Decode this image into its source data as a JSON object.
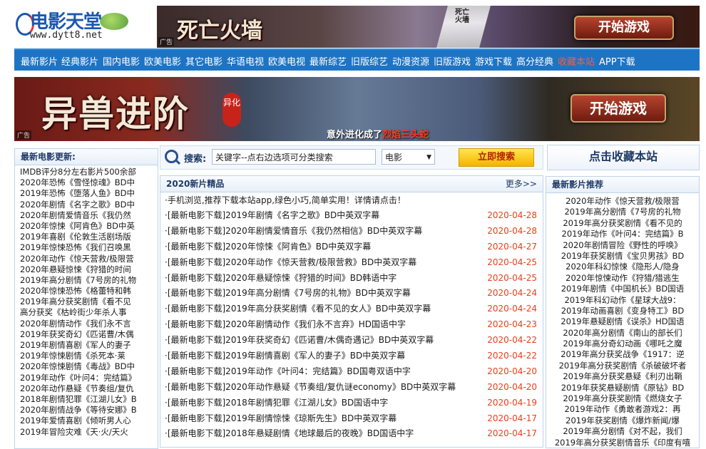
{
  "logo": {
    "title": "电影天堂",
    "url": "www.dytt8.net"
  },
  "top_banner": {
    "game_title": "死亡火墙",
    "sign_text": "死亡火墙",
    "button": "开始游戏",
    "ad_tag": "广告"
  },
  "nav": [
    "最新影片",
    "经典影片",
    "国内电影",
    "欧美电影",
    "其它电影",
    "华语电视",
    "欧美电视",
    "最新综艺",
    "旧版综艺",
    "动漫资源",
    "旧版游戏",
    "游戏下载",
    "高分经典",
    "收藏本站",
    "APP下载"
  ],
  "nav_highlight_color": "#ff5a3c",
  "mid_banner": {
    "title": "异兽进阶",
    "seal": "异化",
    "caption_prefix": "意外进化成了",
    "caption_highlight": "烈焰三头蛇",
    "button": "开始游戏",
    "ad_tag": "广告"
  },
  "left": {
    "title": "最新电影更新:",
    "items": [
      "IMDB评分8分左右影片500余部",
      "2020年恐怖《雪怪惊魂》BD中",
      "2019年恐怖《堕落人鱼》BD中",
      "2020年剧情《名字之歌》BD中",
      "2020年剧情爱情音乐《我仍然",
      "2020年惊悚《阿肯色》BD中英",
      "2019年喜剧《伦敦生活剧场版",
      "2019年惊悚恐怖《我们召唤黑",
      "2020年动作《惊天营救/极限营",
      "2020年悬疑惊悚《狩猎的时间",
      "2019年高分剧情《7号房的礼物",
      "2020年惊悚恐怖《格蕾特和韩",
      "2019年高分获奖剧情《看不见",
      "高分获奖《枯岭街少年杀人事",
      "2020年剧情动作《我们永不言",
      "2019年获奖奇幻《匹诺曹/木偶",
      "2019年剧情喜剧《军人的妻子",
      "2019年惊悚剧情《杀死本·莱",
      "2020年惊悚剧情《毒战》BD中",
      "2019年动作《叶问4：完结篇》",
      "2020年动作悬疑《节奏组/复仇",
      "2018年剧情犯罪《江湖儿女》B",
      "2020年剧情战争《等待安娜》B",
      "2019年爱情喜剧《倾听男人心",
      "2019年冒险灾难《天·火/天火"
    ]
  },
  "search": {
    "label": "搜索:",
    "input_value": "关键字--点右边选项可分类搜索",
    "category": "电影",
    "button": "立即搜索"
  },
  "favorite": "点击收藏本站",
  "center": {
    "title": "2020新片精品",
    "more": "更多>>",
    "notice": "·手机浏览,推荐下载本站app,绿色小巧,简单实用！详情请点击！",
    "date_color": "#e8401a",
    "rows": [
      {
        "text": "·[最新电影下载]2019年剧情《名字之歌》BD中英双字幕",
        "date": "2020-04-28"
      },
      {
        "text": "·[最新电影下载]2020年剧情爱情音乐《我仍然相信》BD中英双字幕",
        "date": "2020-04-28"
      },
      {
        "text": "·[最新电影下载]2020年惊悚《阿肯色》BD中英双字幕",
        "date": "2020-04-27"
      },
      {
        "text": "·[最新电影下载]2020年动作《惊天营救/极限营救》BD中英双字幕",
        "date": "2020-04-25"
      },
      {
        "text": "·[最新电影下载]2020年悬疑惊悚《狩猎的时间》BD韩语中字",
        "date": "2020-04-25"
      },
      {
        "text": "·[最新电影下载]2019年高分剧情《7号房的礼物》BD中英双字幕",
        "date": "2020-04-24"
      },
      {
        "text": "·[最新电影下载]2019年高分获奖剧情《看不见的女人》BD中英双字幕",
        "date": "2020-04-24"
      },
      {
        "text": "·[最新电影下载]2020年剧情动作《我们永不言弃》HD国语中字",
        "date": "2020-04-23"
      },
      {
        "text": "·[最新电影下载]2019年获奖奇幻《匹诺曹/木偶奇遇记》BD中英双字幕",
        "date": "2020-04-22"
      },
      {
        "text": "·[最新电影下载]2019年剧情喜剧《军人的妻子》BD中英双字幕",
        "date": "2020-04-22"
      },
      {
        "text": "·[最新电影下载]2019年动作《叶问4：完结篇》BD国粤双语中字",
        "date": "2020-04-20"
      },
      {
        "text": "·[最新电影下载]2020年动作悬疑《节奏组/复仇谜economy》BD中英双字幕",
        "date": "2020-04-20"
      },
      {
        "text": "·[最新电影下载]2018年剧情犯罪《江湖儿女》BD国语中字",
        "date": "2020-04-19"
      },
      {
        "text": "·[最新电影下载]2019年剧情惊悚《琼斯先生》BD中英双字幕",
        "date": "2020-04-17"
      },
      {
        "text": "·[最新电影下载]2018年悬疑剧情《地球最后的夜晚》BD国语中字",
        "date": "2020-04-17"
      }
    ]
  },
  "right": {
    "title": "最新影片推荐",
    "items": [
      "2020年动作《惊天营救/极限营",
      "2019年高分剧情《7号房的礼物",
      "2019年高分获奖剧情《看不见的",
      "2019年动作《叶问4：完结篇》B",
      "2020年剧情冒险《野性的呼唤》",
      "2019年获奖剧情《宝贝男孩》BD",
      "2020年科幻惊悚《隐形人/隐身",
      "2020年惊悚动作《狩猎/猎逃生",
      "2019年剧情《中国机长》BD国语",
      "2019年科幻动作《星球大战9：",
      "2019年动画喜剧《变身特工》BD",
      "2019年悬疑剧情《误杀》HD国语",
      "2020年高分剧情《南山的部长们",
      "2019年高分奇幻动画《哪吒之魔",
      "2019年高分获奖战争《1917：逆",
      "2019年高分获奖剧情《杀破破坏者",
      "2019年高分获奖悬疑《利刃出鞘",
      "2019年获奖悬疑剧情《原钻》BD",
      "2019年高分获奖剧情《燃烧女子",
      "2019年动作《勇敢者游戏2：再",
      "2019年获奖剧情《爆炸新闻/爆",
      "2019年高分剧情《对不起，我们",
      "2019年高分获奖剧情音乐《印度有嘻"
    ]
  }
}
